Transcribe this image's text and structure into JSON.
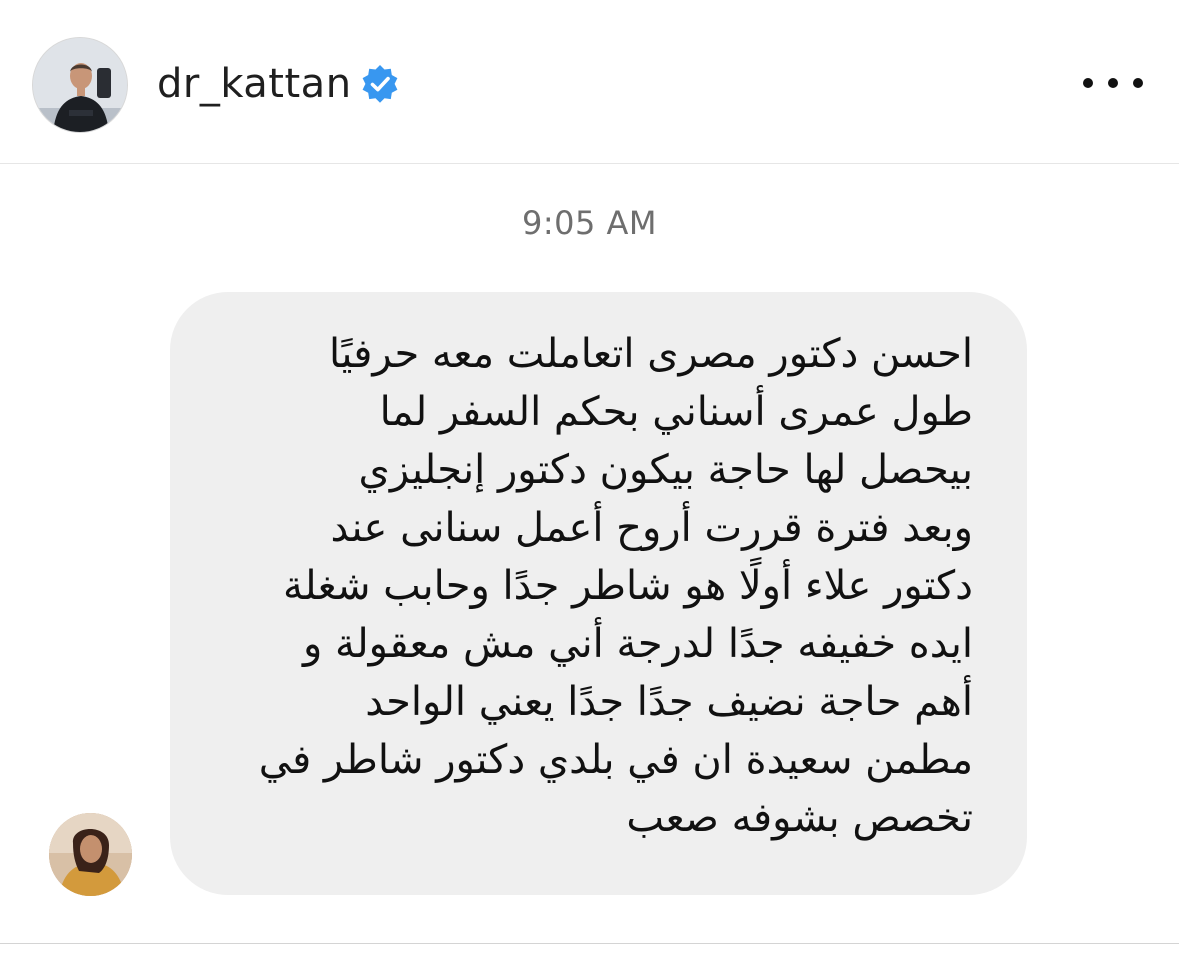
{
  "header": {
    "username": "dr_kattan",
    "verified_icon": "verified-badge-icon",
    "more_icon": "more-options-icon",
    "colors": {
      "verified": "#3897f0"
    }
  },
  "conversation": {
    "timestamp": "9:05 AM",
    "message": {
      "lines": [
        "احسن دكتور مصرى اتعاملت معه حرفيًا",
        "طول عمرى أسناني بحكم السفر لما",
        "بيحصل لها حاجة بيكون دكتور إنجليزي",
        "وبعد فترة قررت أروح أعمل سنانى عند",
        "دكتور علاء أولًا هو شاطر جدًا وحابب شغلة",
        "ايده خفيفه جدًا لدرجة أني مش معقولة و",
        "أهم حاجة نضيف جدًا جدًا يعني الواحد",
        "مطمن سعيدة ان في بلدي دكتور شاطر في",
        "تخصص بشوفه صعب"
      ]
    }
  }
}
